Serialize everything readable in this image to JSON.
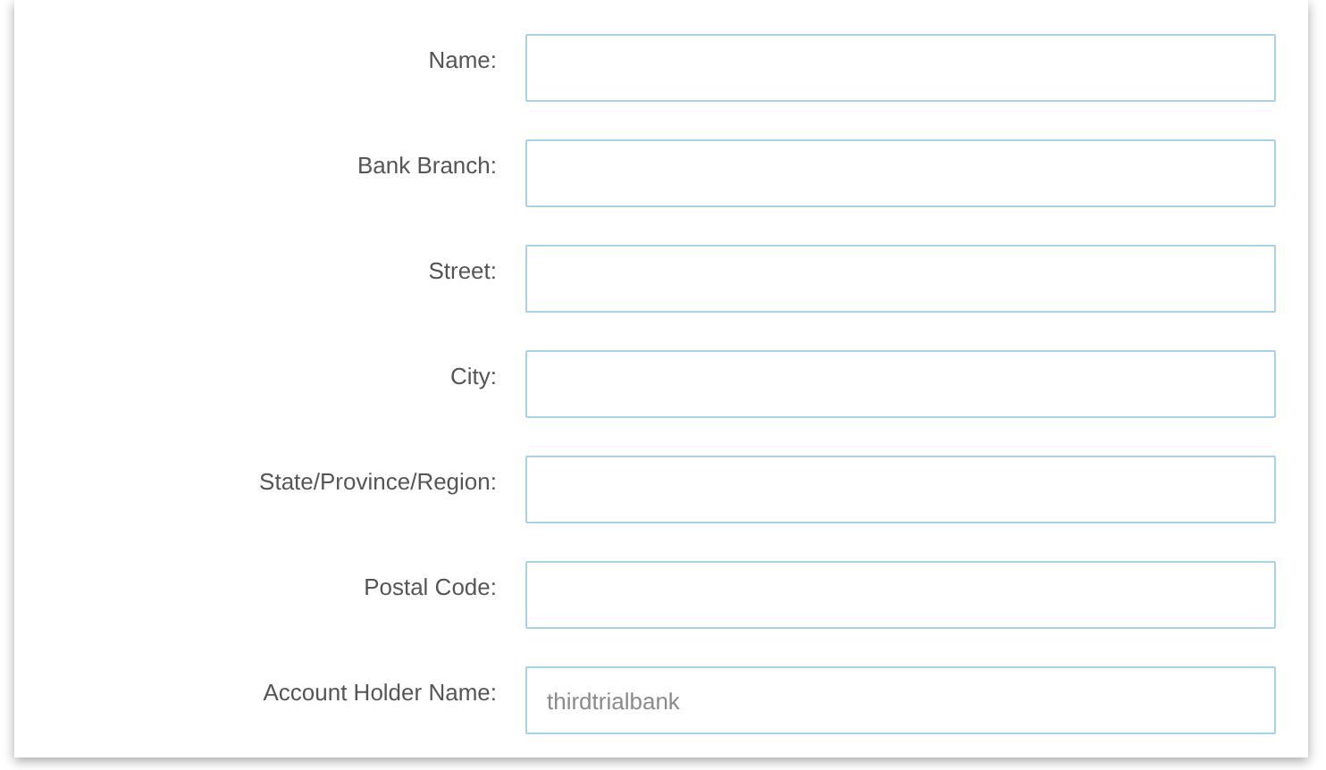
{
  "fields": [
    {
      "label": "Name:"
    },
    {
      "label": "Bank Branch:"
    },
    {
      "label": "Street:"
    },
    {
      "label": "City:"
    },
    {
      "label": "State/Province/Region:"
    },
    {
      "label": "Postal Code:"
    },
    {
      "label": "Account Holder Name:",
      "placeholder": "thirdtrialbank"
    }
  ]
}
